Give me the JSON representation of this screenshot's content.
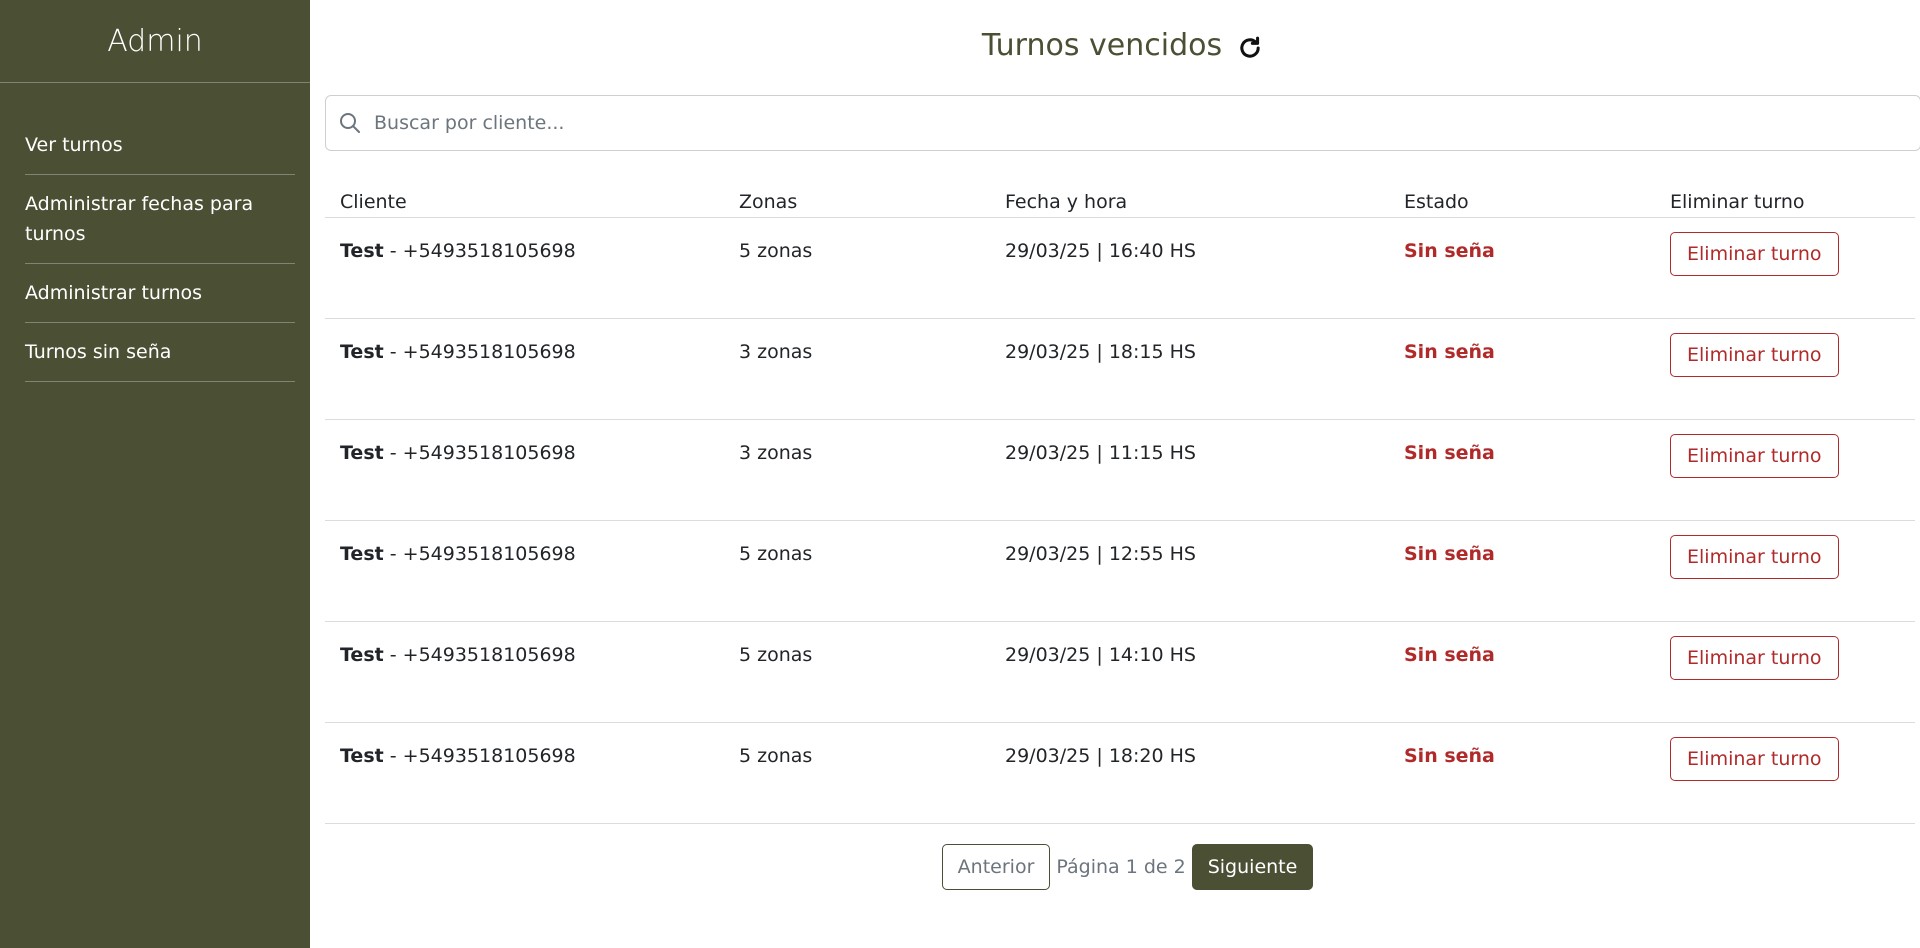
{
  "sidebar": {
    "title": "Admin",
    "items": [
      {
        "label": "Ver turnos"
      },
      {
        "label": "Administrar fechas para turnos"
      },
      {
        "label": "Administrar turnos"
      },
      {
        "label": "Turnos sin seña"
      }
    ]
  },
  "header": {
    "title": "Turnos vencidos",
    "refresh_icon": "refresh-icon"
  },
  "search": {
    "placeholder": "Buscar por cliente...",
    "value": "",
    "icon": "search-icon"
  },
  "table": {
    "columns": [
      "Cliente",
      "Zonas",
      "Fecha y hora",
      "Estado",
      "Eliminar turno"
    ],
    "rows": [
      {
        "name": "Test",
        "phone": " - +5493518105698",
        "zonas": "5 zonas",
        "fecha": "29/03/25 | 16:40 HS",
        "estado": "Sin seña",
        "action": "Eliminar turno"
      },
      {
        "name": "Test",
        "phone": " - +5493518105698",
        "zonas": "3 zonas",
        "fecha": "29/03/25 | 18:15 HS",
        "estado": "Sin seña",
        "action": "Eliminar turno"
      },
      {
        "name": "Test",
        "phone": " - +5493518105698",
        "zonas": "3 zonas",
        "fecha": "29/03/25 | 11:15 HS",
        "estado": "Sin seña",
        "action": "Eliminar turno"
      },
      {
        "name": "Test",
        "phone": " - +5493518105698",
        "zonas": "5 zonas",
        "fecha": "29/03/25 | 12:55 HS",
        "estado": "Sin seña",
        "action": "Eliminar turno"
      },
      {
        "name": "Test",
        "phone": " - +5493518105698",
        "zonas": "5 zonas",
        "fecha": "29/03/25 | 14:10 HS",
        "estado": "Sin seña",
        "action": "Eliminar turno"
      },
      {
        "name": "Test",
        "phone": " - +5493518105698",
        "zonas": "5 zonas",
        "fecha": "29/03/25 | 18:20 HS",
        "estado": "Sin seña",
        "action": "Eliminar turno"
      }
    ]
  },
  "pagination": {
    "prev_label": "Anterior",
    "info": "Página 1 de 2",
    "next_label": "Siguiente"
  },
  "colors": {
    "sidebar_bg": "#4b4f33",
    "accent": "#4b4f33",
    "danger": "#b02a2a"
  }
}
